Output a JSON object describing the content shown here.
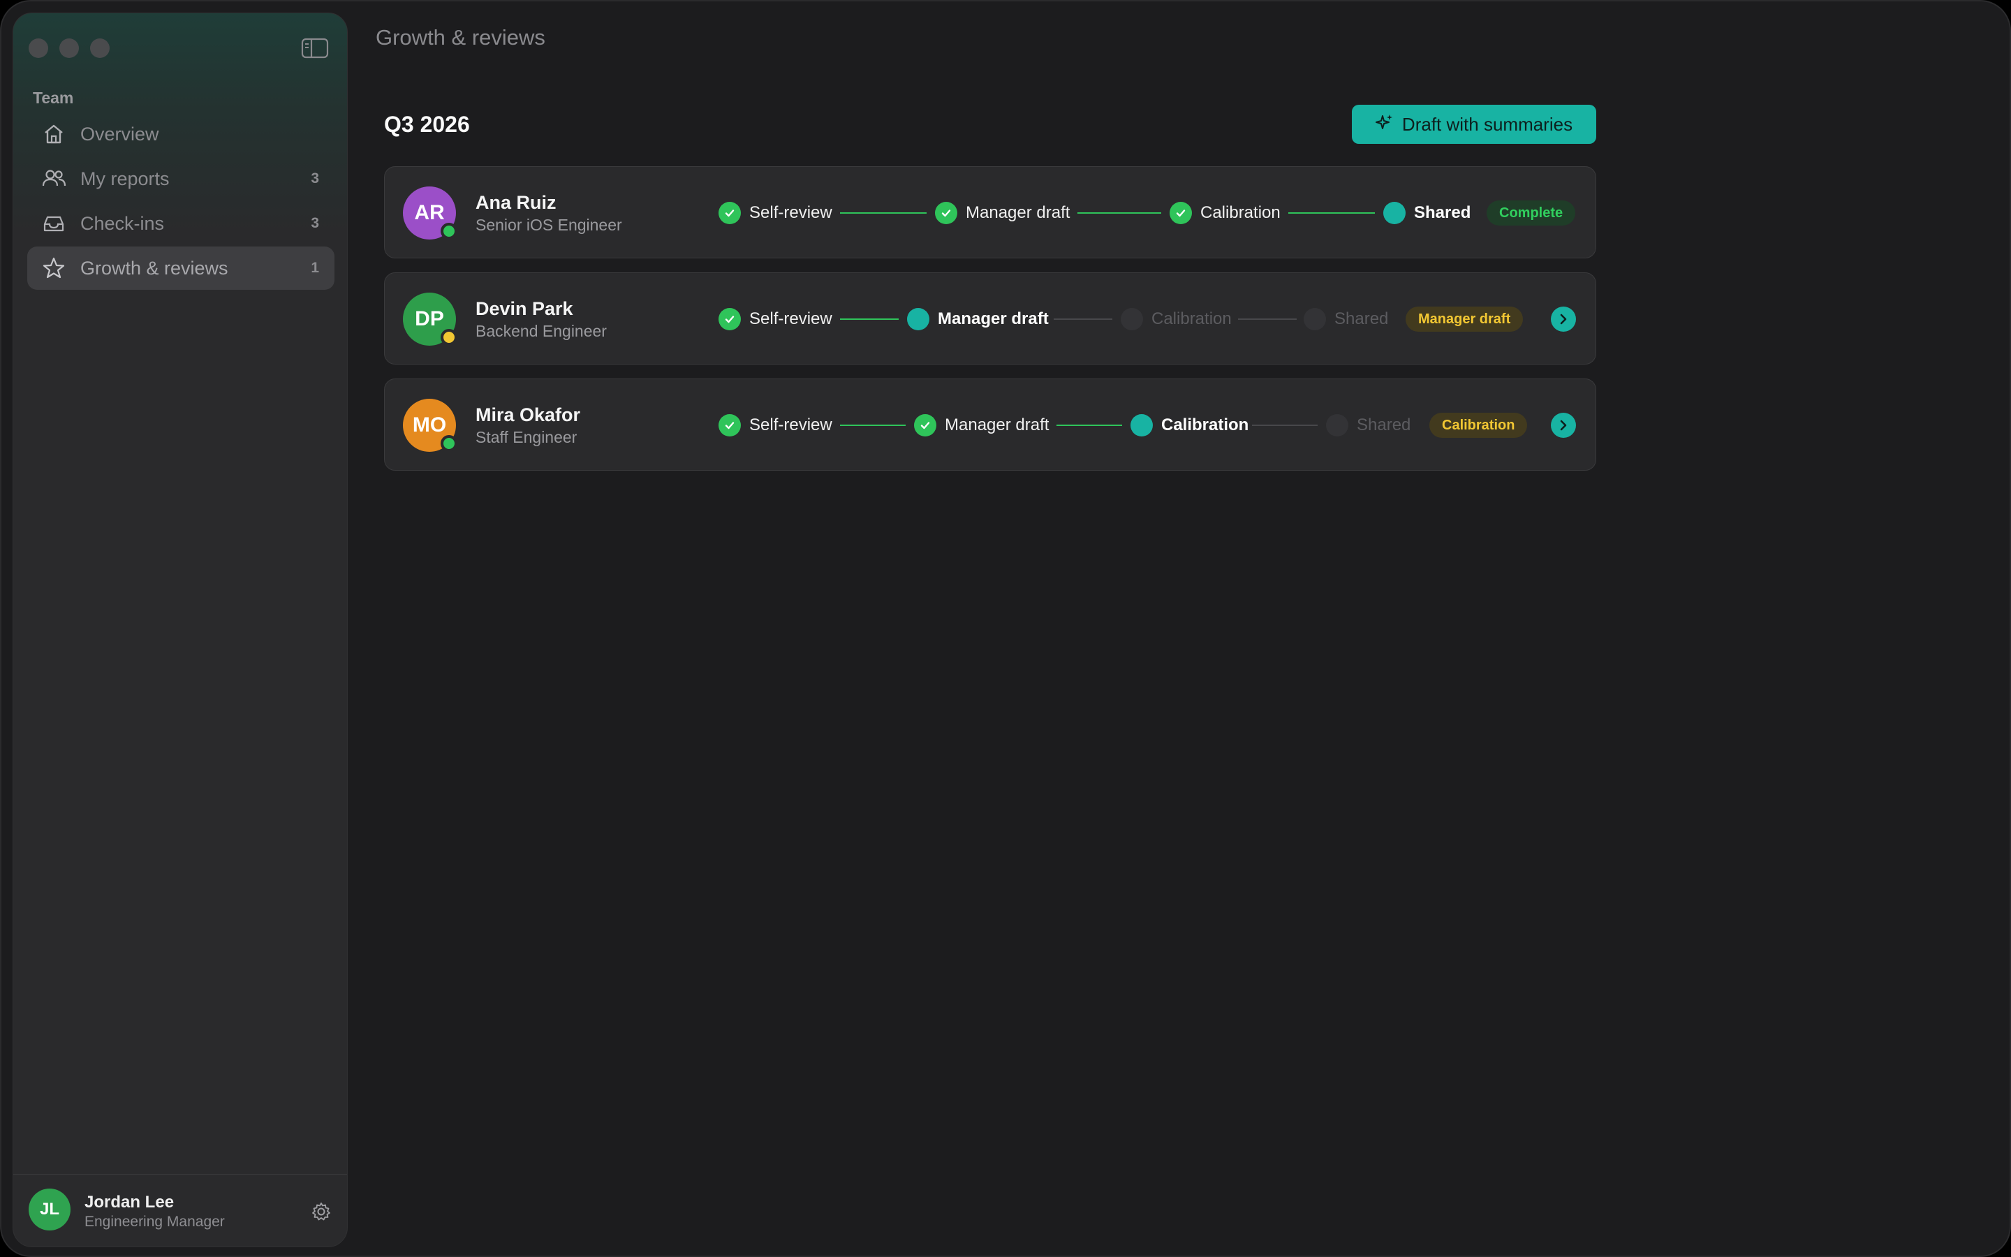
{
  "sidebar": {
    "section": "Team",
    "items": [
      {
        "label": "Overview",
        "count": "",
        "icon": "home-icon"
      },
      {
        "label": "My reports",
        "count": "3",
        "icon": "people-icon"
      },
      {
        "label": "Check-ins",
        "count": "3",
        "icon": "inbox-icon"
      },
      {
        "label": "Growth & reviews",
        "count": "1",
        "icon": "star-icon"
      }
    ],
    "user": {
      "initials": "JL",
      "name": "Jordan Lee",
      "role": "Engineering Manager"
    }
  },
  "header": {
    "title": "Growth & reviews"
  },
  "main": {
    "quarter": "Q3 2026",
    "draft_button": "Draft with summaries",
    "people": [
      {
        "initials": "AR",
        "name": "Ana Ruiz",
        "role": "Senior iOS Engineer",
        "avatar_color": "#9b4fc8",
        "presence": "#2fc45a",
        "steps": [
          {
            "label": "Self-review",
            "state": "done"
          },
          {
            "label": "Manager draft",
            "state": "done"
          },
          {
            "label": "Calibration",
            "state": "done"
          },
          {
            "label": "Shared",
            "state": "current"
          }
        ],
        "badge": "Complete"
      },
      {
        "initials": "DP",
        "name": "Devin Park",
        "role": "Backend Engineer",
        "avatar_color": "#2e9e4b",
        "presence": "#f2c733",
        "steps": [
          {
            "label": "Self-review",
            "state": "done"
          },
          {
            "label": "Manager draft",
            "state": "current"
          },
          {
            "label": "Calibration",
            "state": "pending"
          },
          {
            "label": "Shared",
            "state": "pending"
          }
        ],
        "badge": "Manager draft"
      },
      {
        "initials": "MO",
        "name": "Mira Okafor",
        "role": "Staff Engineer",
        "avatar_color": "#e58a1f",
        "presence": "#2fc45a",
        "steps": [
          {
            "label": "Self-review",
            "state": "done"
          },
          {
            "label": "Manager draft",
            "state": "done"
          },
          {
            "label": "Calibration",
            "state": "current"
          },
          {
            "label": "Shared",
            "state": "pending"
          }
        ],
        "badge": "Calibration"
      }
    ]
  },
  "colors": {
    "accent": "#18b3a3",
    "done": "#2fc45a",
    "warn": "#f2c733"
  }
}
